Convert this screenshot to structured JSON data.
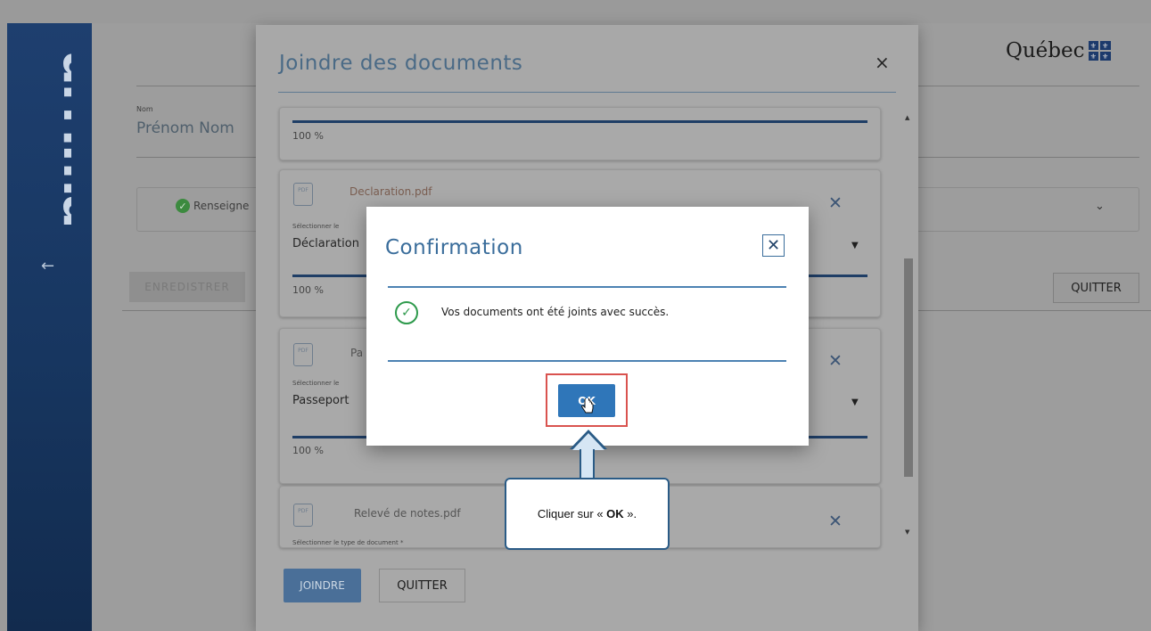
{
  "brand": {
    "logo_text": "arrima",
    "back_icon": "arrow-left-icon"
  },
  "header": {
    "gov_name": "Québec",
    "flag_glyph": "⚜"
  },
  "background_form": {
    "name_label": "Nom",
    "name_value": "Prénom Nom",
    "status_text": "Renseigne",
    "save_label": "ENREDISTRER",
    "quit_label": "QUITTER"
  },
  "documents_dialog": {
    "title": "Joindre des documents",
    "close_glyph": "×",
    "type_label": "Sélectionner le type de document *",
    "type_label_short": "Sélectionner le",
    "cards": [
      {
        "progress_text": "100 %"
      },
      {
        "file_name": "Declaration.pdf",
        "doc_type": "Déclaration",
        "progress_text": "100 %"
      },
      {
        "file_name": "Pa",
        "doc_type": "Passeport",
        "progress_text": "100 %"
      },
      {
        "file_name": "Relevé de notes.pdf"
      }
    ],
    "pdf_badge": "PDF",
    "join_label": "JOINDRE",
    "quit_label": "QUITTER"
  },
  "confirmation": {
    "title": "Confirmation",
    "close_glyph": "✕",
    "message": "Vos documents ont été joints avec succès.",
    "ok_label": "OK"
  },
  "callout": {
    "text_before": "Cliquer sur « ",
    "text_bold": "OK",
    "text_after": " »."
  },
  "colors": {
    "accent": "#2f76b9",
    "success": "#2e9a4c",
    "highlight": "#d9534f",
    "sidebar": "#1e3f6f"
  }
}
